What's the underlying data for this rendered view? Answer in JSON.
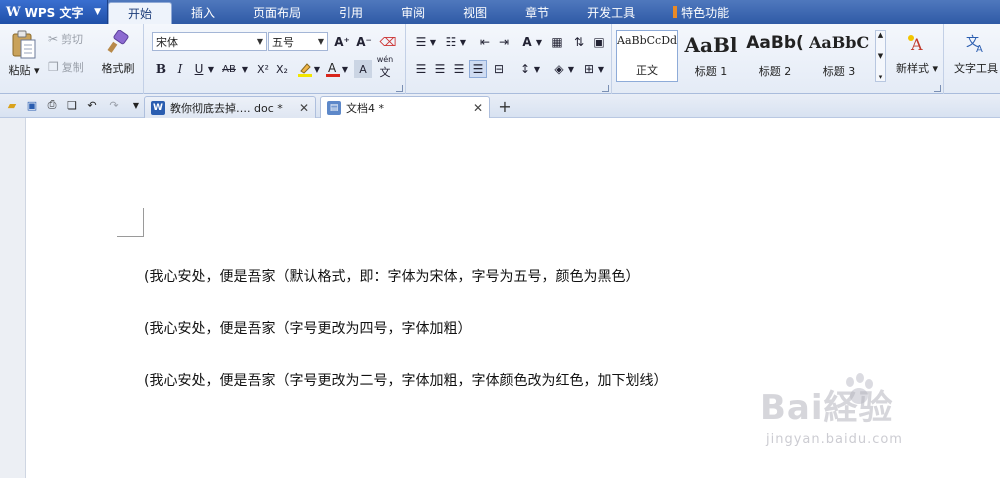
{
  "app": {
    "name": "WPS 文字",
    "logo": "W"
  },
  "menu": {
    "tabs": [
      {
        "label": "开始"
      },
      {
        "label": "插入"
      },
      {
        "label": "页面布局"
      },
      {
        "label": "引用"
      },
      {
        "label": "审阅"
      },
      {
        "label": "视图"
      },
      {
        "label": "章节"
      },
      {
        "label": "开发工具"
      },
      {
        "label": "特色功能"
      }
    ],
    "active_index": 0
  },
  "ribbon": {
    "clipboard": {
      "paste": "粘贴",
      "cut": "剪切",
      "copy": "复制",
      "format_painter": "格式刷"
    },
    "font": {
      "font_name": "宋体",
      "font_size": "五号",
      "bold": "B",
      "italic": "I",
      "underline": "U",
      "strike": "AB",
      "superscript": "X²",
      "subscript": "X₂",
      "grow": "A⁺",
      "shrink": "A⁻",
      "font_color_accent": "#d9261c",
      "highlight_accent": "#f2e600",
      "pinyin": "wén"
    },
    "styles": {
      "items": [
        {
          "preview": "AaBbCcDd",
          "label": "正文"
        },
        {
          "preview": "AaBl",
          "label": "标题 1"
        },
        {
          "preview": "AaBb(",
          "label": "标题 2"
        },
        {
          "preview": "AaBbC",
          "label": "标题 3"
        }
      ]
    },
    "new_style": "新样式",
    "text_tools": "文字工具"
  },
  "tabs": [
    {
      "title": "教你彻底去掉…. doc *",
      "active": false
    },
    {
      "title": "文档4 *",
      "active": true
    }
  ],
  "document": {
    "paragraphs": [
      "(我心安处，便是吾家（默认格式，即：字体为宋体，字号为五号，颜色为黑色）",
      "(我心安处，便是吾家（字号更改为四号，字体加粗）",
      "(我心安处，便是吾家（字号更改为二号，字体加粗，字体颜色改为红色，加下划线）"
    ]
  },
  "watermark": {
    "brand": "Bai経验",
    "url": "jingyan.baidu.com"
  },
  "colors": {
    "menu_bar": "#3b64ad",
    "accent_orange": "#e98a26"
  }
}
